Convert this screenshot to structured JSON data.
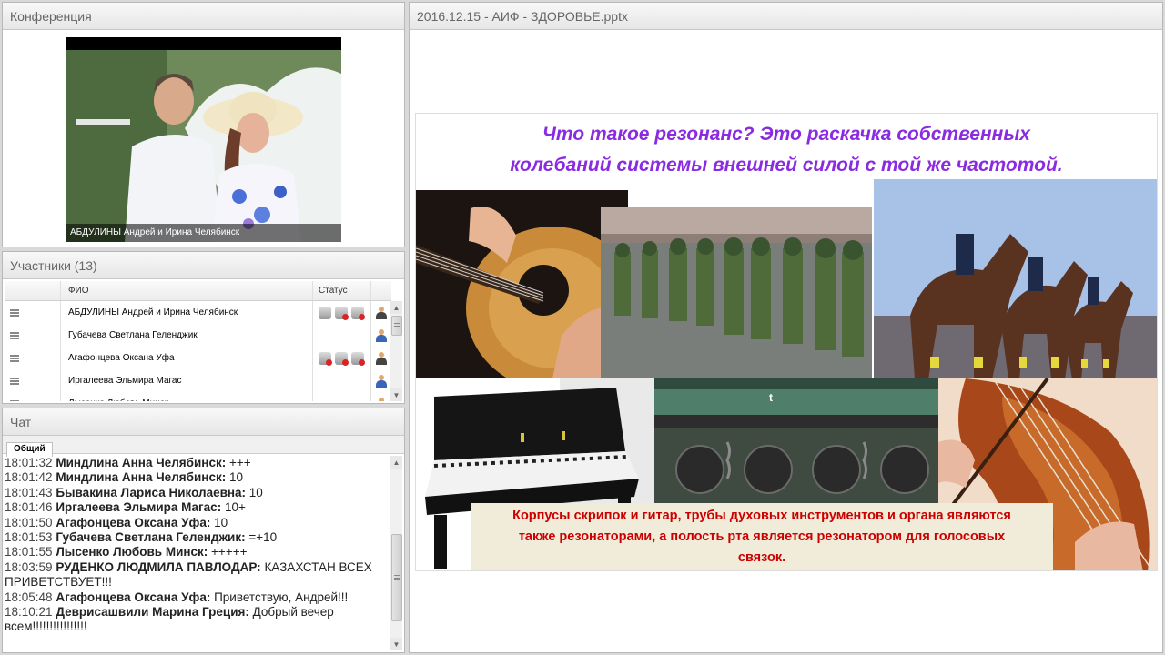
{
  "conference": {
    "title": "Конференция",
    "video_caption": "АБДУЛИНЫ Андрей и Ирина Челябинск"
  },
  "participants": {
    "title": "Участники (13)",
    "columns": {
      "name": "ФИО",
      "status": "Статус"
    },
    "rows": [
      {
        "name": "АБДУЛИНЫ Андрей и Ирина Челябинск"
      },
      {
        "name": "Губачева Светлана  Геленджик"
      },
      {
        "name": "Агафонцева Оксана Уфа"
      },
      {
        "name": "Иргалеева Эльмира Магас"
      },
      {
        "name": "Лысенко Любовь Минск"
      }
    ]
  },
  "chat": {
    "title": "Чат",
    "tab": "Общий",
    "messages": [
      {
        "time": "18:01:32",
        "author": "Миндлина Анна  Челябинск:",
        "text": " +++"
      },
      {
        "time": "18:01:42",
        "author": "Миндлина Анна  Челябинск:",
        "text": " 10"
      },
      {
        "time": "18:01:43",
        "author": "Бывакина Лариса  Николаевна:",
        "text": " 10"
      },
      {
        "time": "18:01:46",
        "author": "Иргалеева Эльмира Магас:",
        "text": " 10+"
      },
      {
        "time": "18:01:50",
        "author": "Агафонцева Оксана Уфа:",
        "text": " 10"
      },
      {
        "time": "18:01:53",
        "author": "Губачева Светлана  Геленджик:",
        "text": " =+10"
      },
      {
        "time": "18:01:55",
        "author": "Лысенко Любовь  Минск:",
        "text": " +++++"
      },
      {
        "time": "18:03:59",
        "author": "РУДЕНКО ЛЮДМИЛА  ПАВЛОДАР:",
        "text": " КАЗАХСТАН ВСЕХ ПРИВЕТСТВУЕТ!!!"
      },
      {
        "time": "18:05:48",
        "author": "Агафонцева Оксана Уфа:",
        "text": " Приветствую, Андрей!!!"
      },
      {
        "time": "18:10:21",
        "author": "Деврисашвили   Марина  Греция:",
        "text": " Добрый вечер всем!!!!!!!!!!!!!!!!"
      }
    ]
  },
  "presentation": {
    "title": "2016.12.15 - АИФ - ЗДОРОВЬЕ.pptx",
    "slide_title_line1": "Что  такое резонанс?  Это раскачка собственных",
    "slide_title_line2": "колебаний системы внешней силой с той же частотой.",
    "slide_note_line1": "Корпусы скрипок и гитар, трубы духовых инструментов и органа являются",
    "slide_note_line2": "также резонаторами, а полость рта является резонатором для голосовых",
    "slide_note_line3": "связок.",
    "train_mark": "t"
  },
  "colors": {
    "slide_title": "#8a2be2",
    "slide_note_text": "#cc0000",
    "slide_note_bg": "#f1ecd9"
  }
}
